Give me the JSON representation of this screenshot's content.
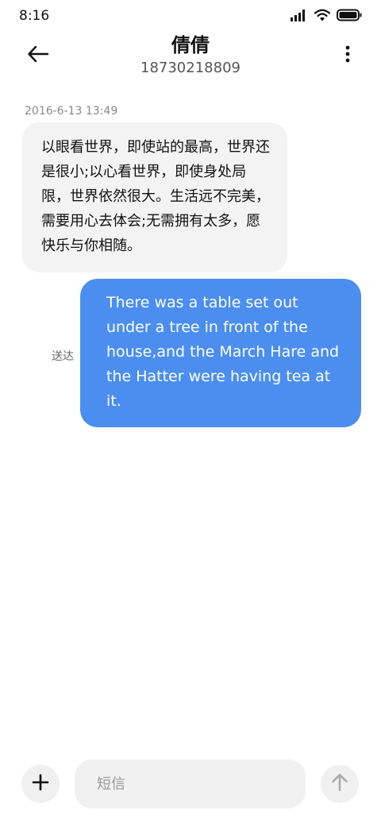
{
  "status_bar": {
    "time": "8:16",
    "icons": [
      "signal-icon",
      "wifi-icon",
      "battery-icon"
    ]
  },
  "header": {
    "back_icon": "arrow-left-icon",
    "contact_name": "倩倩",
    "contact_number": "18730218809",
    "more_icon": "more-vertical-icon"
  },
  "conversation": {
    "timestamp": "2016-6-13 13:49",
    "incoming_message": "以眼看世界，即使站的最高，世界还是很小;以心看世界，即使身处局限，世界依然很大。生活远不完美，需要用心去体会;无需拥有太多，愿快乐与你相随。",
    "outgoing_message": "There was a table set out under a tree in front of the house,and the March Hare and the Hatter were having tea at it.",
    "outgoing_status": "送达"
  },
  "composer": {
    "add_icon": "plus-icon",
    "placeholder": "短信",
    "send_icon": "arrow-up-icon"
  },
  "colors": {
    "incoming_bubble": "#f3f3f3",
    "outgoing_bubble": "#4b8ef0",
    "timestamp_text": "#8a8a8a"
  }
}
